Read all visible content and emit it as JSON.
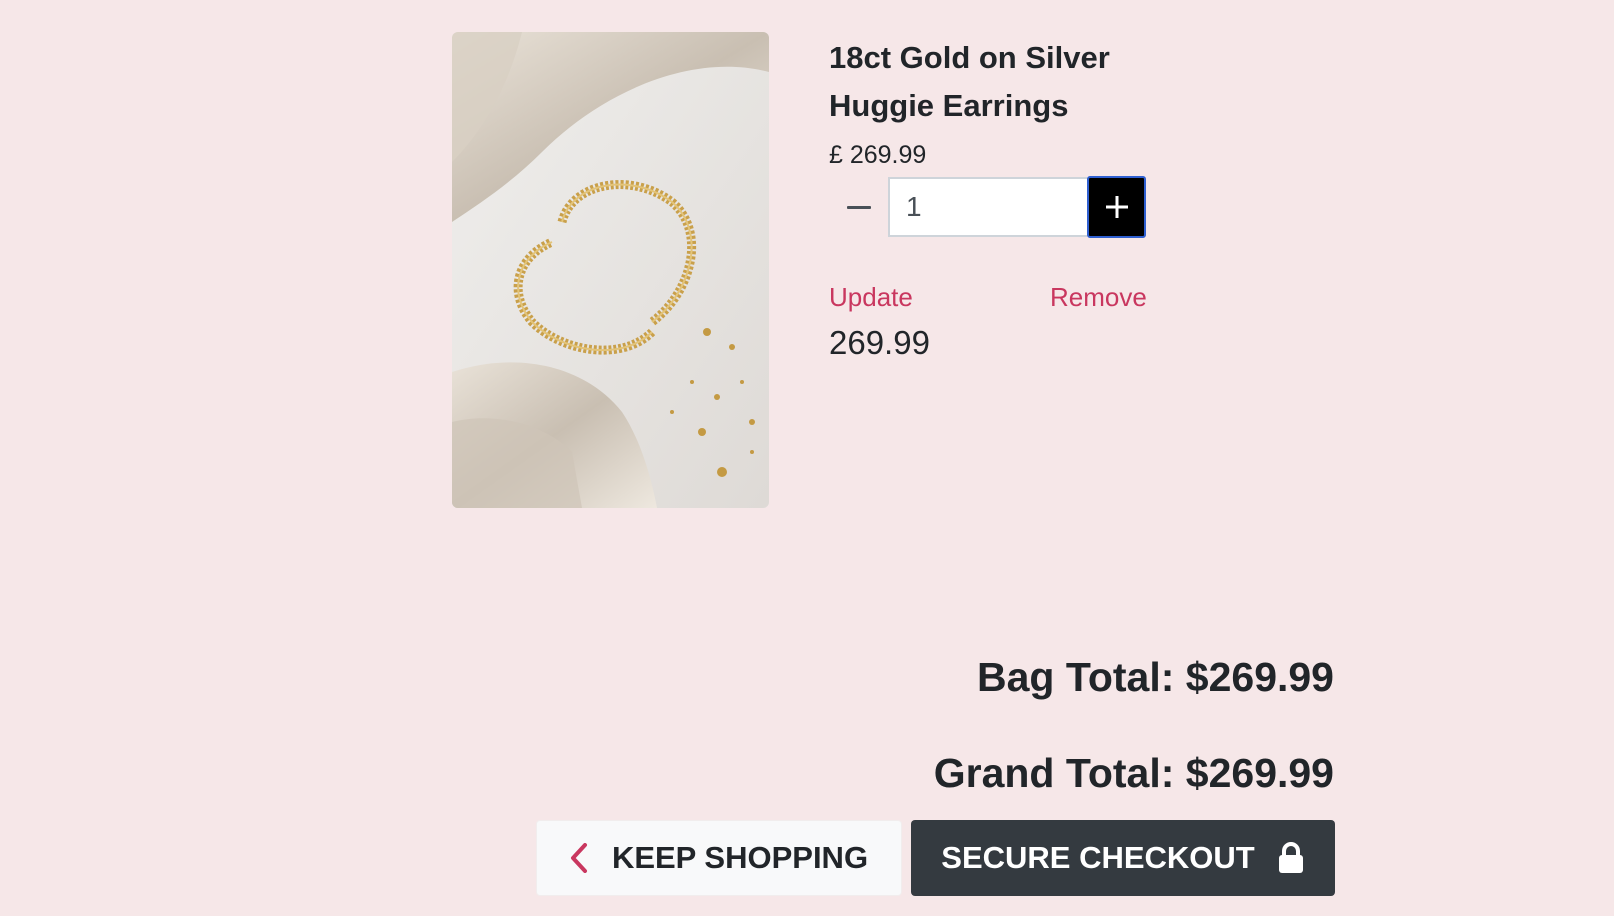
{
  "product": {
    "title": "18ct Gold on Silver Huggie Earrings",
    "unit_price": "£ 269.99",
    "quantity": "1",
    "image_icon": "gold-hoop-earrings-photo",
    "line_total": "269.99"
  },
  "actions": {
    "update_label": "Update",
    "remove_label": "Remove",
    "minus_icon": "minus-icon",
    "plus_icon": "plus-icon"
  },
  "totals": {
    "bag_total": "Bag Total: $269.99",
    "grand_total": "Grand Total: $269.99"
  },
  "buttons": {
    "keep_shopping": "KEEP SHOPPING",
    "secure_checkout": "SECURE CHECKOUT",
    "keep_shopping_icon": "chevron-left-icon",
    "checkout_icon": "lock-icon"
  },
  "colors": {
    "background": "#f6e7e8",
    "link": "#c9375f",
    "checkout_button": "#343a40",
    "plus_button": "#000000"
  }
}
